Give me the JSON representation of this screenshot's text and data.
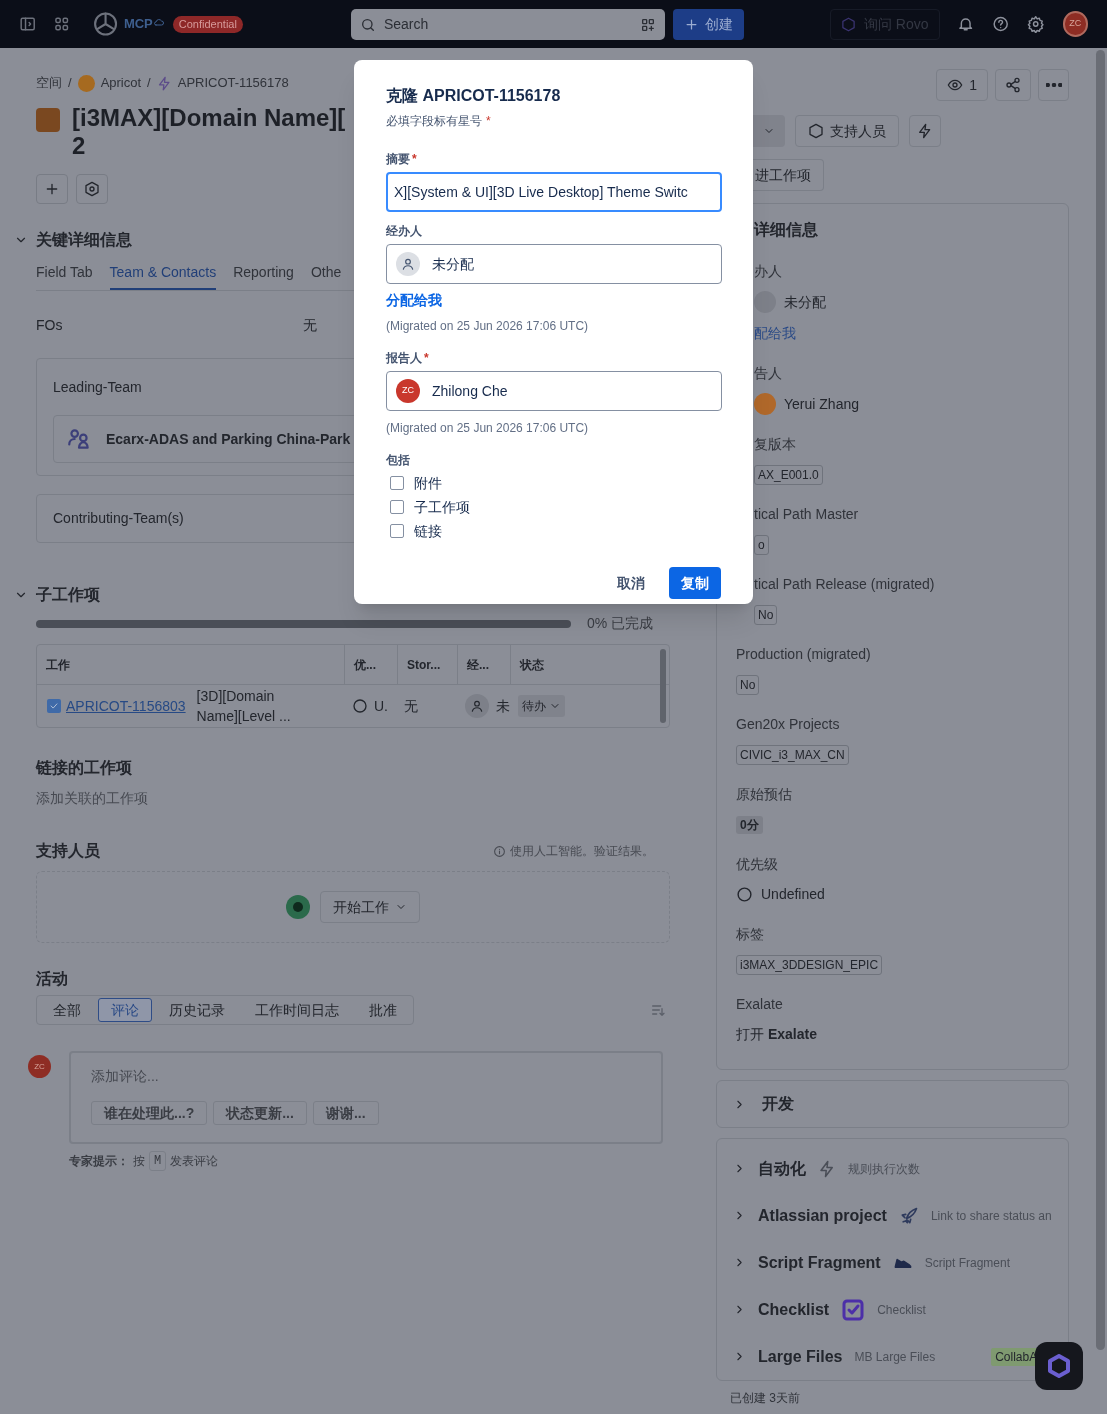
{
  "topbar": {
    "logo_text": "MCP",
    "badge": "Confidential",
    "search": {
      "placeholder": "Search"
    },
    "create_button": "创建",
    "rovo_button": "询问 Rovo",
    "avatar": "ZC"
  },
  "breadcrumbs": [
    "空间",
    "Apricot",
    "APRICOT-1156178"
  ],
  "breadcrumb_separator": "/",
  "issue_title": {
    "line1": "[i3MAX][Domain Name][",
    "line2": "2"
  },
  "header_actions": {
    "watchers": "1"
  },
  "side_buttons": {
    "support": "支持人员",
    "improve": "进工作项"
  },
  "key_details": {
    "title": "关键详细信息",
    "expanded": true,
    "tabs": [
      {
        "label": "Field Tab",
        "selected": false
      },
      {
        "label": "Team & Contacts",
        "selected": true
      },
      {
        "label": "Reporting",
        "selected": false
      },
      {
        "label": "Othe",
        "selected": false
      }
    ],
    "fos": {
      "label": "FOs",
      "value": "无"
    },
    "leading_team": {
      "label": "Leading-Team",
      "value": "Ecarx-ADAS and Parking China-Park"
    },
    "contributing_team": {
      "label": "Contributing-Team(s)"
    }
  },
  "subtasks": {
    "title": "子工作项",
    "expanded": true,
    "level": 0,
    "progress_text": "0% 已完成",
    "columns": [
      "工作",
      "优...",
      "Stor...",
      "经...",
      "状态"
    ],
    "rows": [
      {
        "key": "APRICOT-1156803",
        "checked": true,
        "summary": "[3D][Domain Name][Level ...",
        "priority": "U.",
        "story": "无",
        "assignee": "未",
        "status": "待办"
      }
    ]
  },
  "linked": {
    "title": "链接的工作项",
    "hint": "添加关联的工作项"
  },
  "support": {
    "title": "支持人员",
    "ai_note": "使用人工智能。验证结果。",
    "start_button": "开始工作"
  },
  "activity": {
    "title": "活动",
    "tabs": [
      {
        "label": "全部",
        "selected": false
      },
      {
        "label": "评论",
        "selected": true
      },
      {
        "label": "历史记录",
        "selected": false
      },
      {
        "label": "工作时间日志",
        "selected": false
      },
      {
        "label": "批准",
        "selected": false
      }
    ],
    "avatar": "ZC",
    "comment_placeholder": "添加评论...",
    "suggestions": [
      "谁在处理此...?",
      "状态更新...",
      "谢谢..."
    ],
    "tip": {
      "label": "专家提示：",
      "before": "按",
      "key": "M",
      "after": "发表评论"
    }
  },
  "details_panel": {
    "title": "详细信息",
    "fields": [
      {
        "kind": "person",
        "label": "办人",
        "value": "未分配",
        "link": "配给我",
        "cut_by_dialog": true
      },
      {
        "kind": "person",
        "label": "告人",
        "value": "Yerui Zhang",
        "color": "#b0682a",
        "cut_by_dialog": true
      },
      {
        "kind": "tag",
        "label": "复版本",
        "value": "AX_E001.0",
        "cut_by_dialog": true
      },
      {
        "kind": "tag",
        "label": "tical Path Master",
        "value": "o",
        "cut_by_dialog": true
      },
      {
        "kind": "tag",
        "label": "tical Path Release (migrated)",
        "value": "No",
        "cut_by_dialog": true
      },
      {
        "kind": "tag",
        "label": "Production (migrated)",
        "value": "No"
      },
      {
        "kind": "tag",
        "label": "Gen20x Projects",
        "value": "CIVIC_i3_MAX_CN"
      },
      {
        "kind": "chip",
        "label": "原始预估",
        "value": "0分"
      },
      {
        "kind": "priority",
        "label": "优先级",
        "value": "Undefined"
      },
      {
        "kind": "tag",
        "label": "标签",
        "value": "i3MAX_3DDESIGN_EPIC"
      },
      {
        "kind": "richtext",
        "label": "Exalate",
        "value": "打开 **Exalate**"
      }
    ]
  },
  "development": {
    "title": "开发",
    "expanded": false
  },
  "apps": [
    {
      "kind": "lightning",
      "title": "自动化",
      "subtitle": "规则执行次数",
      "expanded": false
    },
    {
      "kind": "rocket",
      "title": "Atlassian project",
      "subtitle": "Link to share status an",
      "expanded": false
    },
    {
      "kind": "sneaker",
      "title": "Script Fragment",
      "subtitle": "Script Fragment",
      "expanded": false
    },
    {
      "kind": "checklist",
      "title": "Checklist",
      "subtitle": "Checklist",
      "expanded": false
    },
    {
      "kind": "plain",
      "title": "Large Files",
      "subtitle": "MB Large Files",
      "tag": "CollabA",
      "expanded": false
    }
  ],
  "footer": {
    "created": "已创建 3天前"
  },
  "dialog": {
    "title": "克隆 APRICOT-1156178",
    "required_note": "必填字段标有星号",
    "required_mark": "*",
    "summary": {
      "label": "摘要",
      "required": true,
      "value": "X][System & UI][3D Live Desktop] Theme Switc"
    },
    "assignee": {
      "label": "经办人",
      "value": "未分配",
      "link": "分配给我",
      "note": "(Migrated on 25 Jun 2026 17:06 UTC)"
    },
    "reporter": {
      "label": "报告人",
      "required": true,
      "avatar": "ZC",
      "value": "Zhilong Che",
      "note": "(Migrated on 25 Jun 2026 17:06 UTC)"
    },
    "include": {
      "label": "包括",
      "options": [
        {
          "label": "附件",
          "checked": false
        },
        {
          "label": "子工作项",
          "checked": false
        },
        {
          "label": "链接",
          "checked": false
        }
      ]
    },
    "cancel_button": "取消",
    "confirm_button": "复制"
  }
}
